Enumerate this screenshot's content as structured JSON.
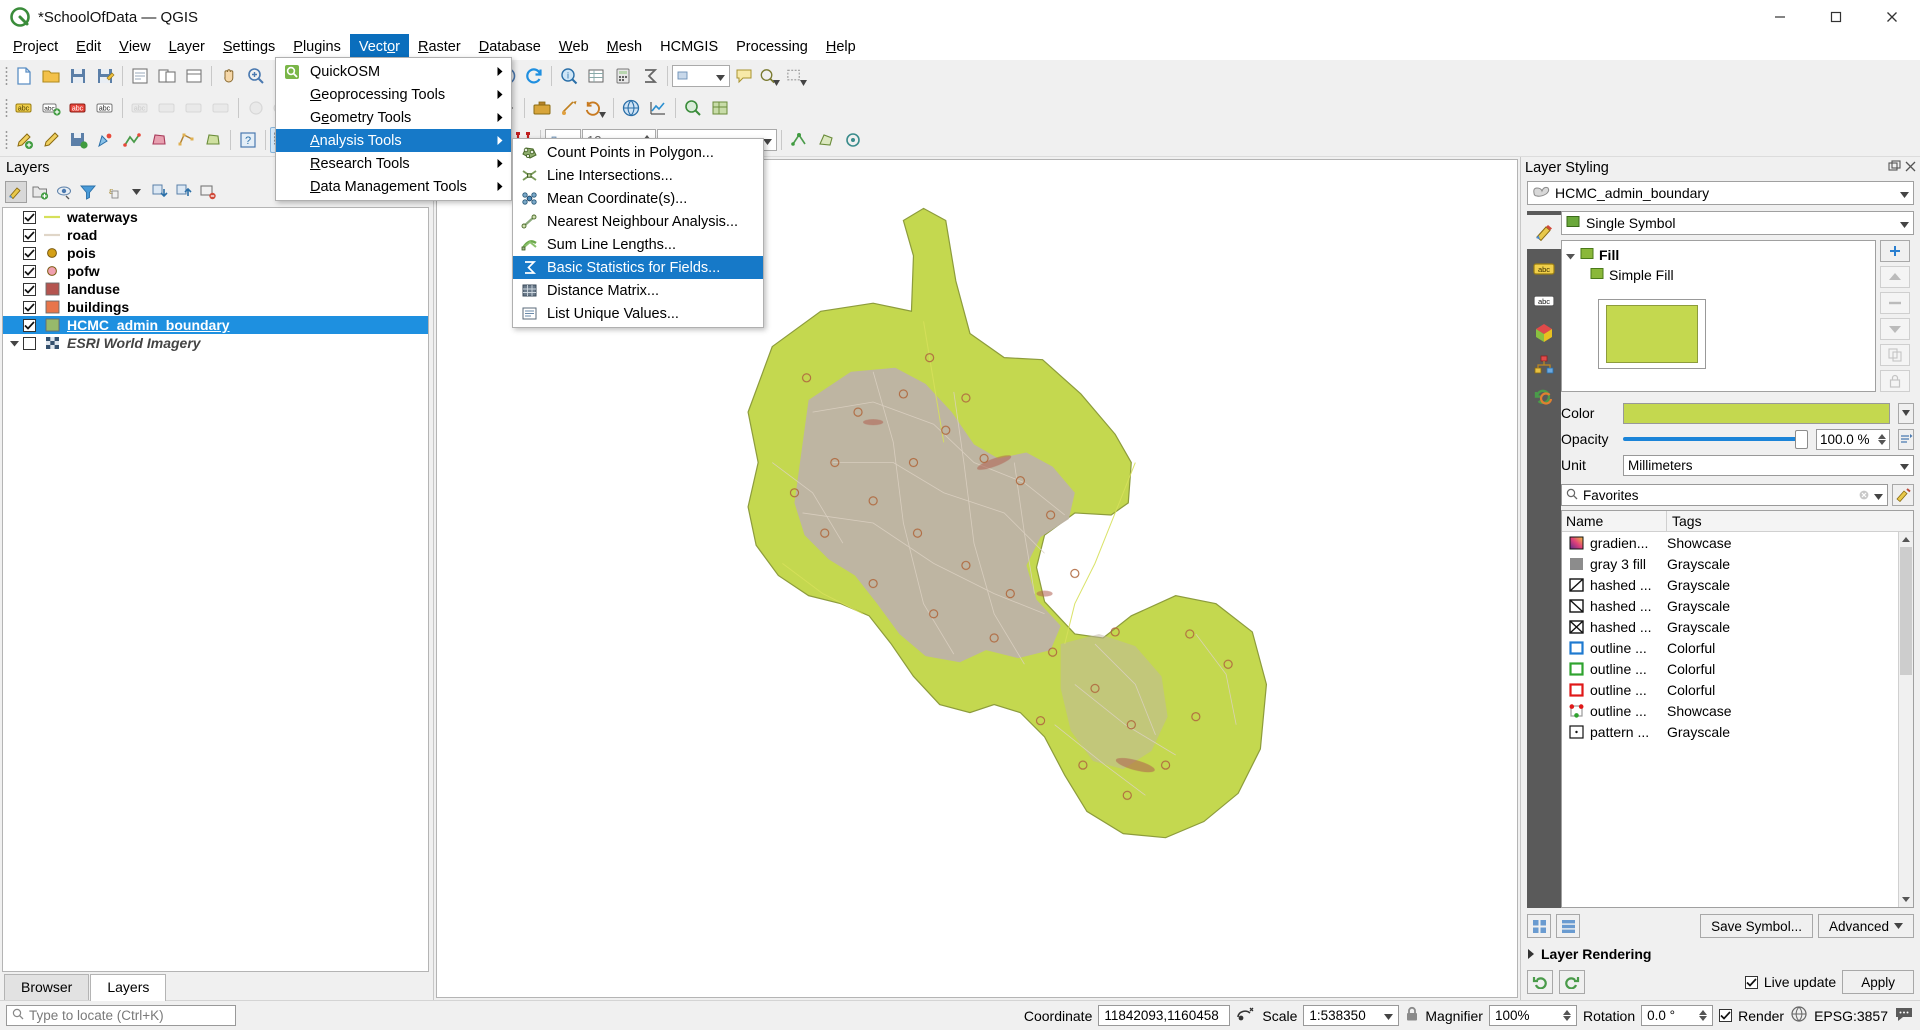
{
  "window": {
    "title": "*SchoolOfData — QGIS",
    "app_icon": "qgis-icon",
    "minimize_label": "Minimize",
    "maximize_label": "Maximize",
    "close_label": "Close"
  },
  "menubar": {
    "items": [
      {
        "label": "Project",
        "mnemonic": "P",
        "active": false
      },
      {
        "label": "Edit",
        "mnemonic": "E",
        "active": false
      },
      {
        "label": "View",
        "mnemonic": "V",
        "active": false
      },
      {
        "label": "Layer",
        "mnemonic": "L",
        "active": false
      },
      {
        "label": "Settings",
        "mnemonic": "S",
        "active": false
      },
      {
        "label": "Plugins",
        "mnemonic": "P",
        "active": false
      },
      {
        "label": "Vector",
        "mnemonic": "o",
        "active": true
      },
      {
        "label": "Raster",
        "mnemonic": "R",
        "active": false
      },
      {
        "label": "Database",
        "mnemonic": "D",
        "active": false
      },
      {
        "label": "Web",
        "mnemonic": "W",
        "active": false
      },
      {
        "label": "Mesh",
        "mnemonic": "M",
        "active": false
      },
      {
        "label": "HCMGIS",
        "mnemonic": "",
        "active": false
      },
      {
        "label": "Processing",
        "mnemonic": "",
        "active": false
      },
      {
        "label": "Help",
        "mnemonic": "H",
        "active": false
      }
    ]
  },
  "vector_menu": {
    "items": [
      {
        "label": "QuickOSM",
        "mnemonic": "",
        "icon": "quickosm-icon",
        "has_submenu": true,
        "highlight": false
      },
      {
        "label": "Geoprocessing Tools",
        "mnemonic": "G",
        "icon": "",
        "has_submenu": true,
        "highlight": false
      },
      {
        "label": "Geometry Tools",
        "mnemonic": "e",
        "icon": "",
        "has_submenu": true,
        "highlight": false
      },
      {
        "label": "Analysis Tools",
        "mnemonic": "A",
        "icon": "",
        "has_submenu": true,
        "highlight": true
      },
      {
        "label": "Research Tools",
        "mnemonic": "R",
        "icon": "",
        "has_submenu": true,
        "highlight": false
      },
      {
        "label": "Data Management Tools",
        "mnemonic": "D",
        "icon": "",
        "has_submenu": true,
        "highlight": false
      }
    ]
  },
  "analysis_submenu": {
    "items": [
      {
        "label": "Count Points in Polygon...",
        "icon": "count-points-icon",
        "highlight": false
      },
      {
        "label": "Line Intersections...",
        "icon": "line-intersections-icon",
        "highlight": false
      },
      {
        "label": "Mean Coordinate(s)...",
        "icon": "mean-coordinate-icon",
        "highlight": false
      },
      {
        "label": "Nearest Neighbour Analysis...",
        "icon": "nearest-neighbour-icon",
        "highlight": false
      },
      {
        "label": "Sum Line Lengths...",
        "icon": "sum-line-lengths-icon",
        "highlight": false
      },
      {
        "label": "Basic Statistics for Fields...",
        "icon": "basic-statistics-icon",
        "highlight": true
      },
      {
        "label": "Distance Matrix...",
        "icon": "distance-matrix-icon",
        "highlight": false
      },
      {
        "label": "List Unique Values...",
        "icon": "list-unique-values-icon",
        "highlight": false
      }
    ]
  },
  "layers_panel": {
    "title": "Layers",
    "toolbar": [
      {
        "name": "open-layer-styling-panel",
        "icon": "paintbrush-icon",
        "pressed": true
      },
      {
        "name": "add-group",
        "icon": "add-group-icon",
        "pressed": false
      },
      {
        "name": "manage-map-themes",
        "icon": "eye-icon",
        "pressed": false
      },
      {
        "name": "filter-legend",
        "icon": "filter-icon",
        "pressed": false
      },
      {
        "name": "filter-legend-expression",
        "icon": "epsilon-icon",
        "pressed": false
      },
      {
        "name": "expand-all",
        "icon": "expand-all-icon",
        "pressed": false
      },
      {
        "name": "collapse-all",
        "icon": "collapse-all-icon",
        "pressed": false
      },
      {
        "name": "remove-layer",
        "icon": "remove-layer-icon",
        "pressed": false
      }
    ],
    "layers": [
      {
        "name": "waterways",
        "checked": true,
        "symbol": "line",
        "color": "#d6e05a",
        "selected": false,
        "italic": false,
        "expander": false
      },
      {
        "name": "road",
        "checked": true,
        "symbol": "line",
        "color": "#e0d6c8",
        "selected": false,
        "italic": false,
        "expander": false
      },
      {
        "name": "pois",
        "checked": true,
        "symbol": "point",
        "color": "#d4a017",
        "selected": false,
        "italic": false,
        "expander": false
      },
      {
        "name": "pofw",
        "checked": true,
        "symbol": "point",
        "color": "#f0a0b0",
        "selected": false,
        "italic": false,
        "expander": false
      },
      {
        "name": "landuse",
        "checked": true,
        "symbol": "fill",
        "color": "#b4544f",
        "selected": false,
        "italic": false,
        "expander": false
      },
      {
        "name": "buildings",
        "checked": true,
        "symbol": "fill",
        "color": "#e8754a",
        "selected": false,
        "italic": false,
        "expander": false
      },
      {
        "name": "HCMC_admin_boundary",
        "checked": true,
        "symbol": "fill",
        "color": "#97b96b",
        "selected": true,
        "italic": false,
        "expander": false
      },
      {
        "name": "ESRI World Imagery",
        "checked": false,
        "symbol": "raster",
        "color": "#6a7f9c",
        "selected": false,
        "italic": true,
        "expander": true
      }
    ],
    "tabs": [
      {
        "label": "Browser",
        "active": false
      },
      {
        "label": "Layers",
        "active": true
      }
    ]
  },
  "layer_styling": {
    "title": "Layer Styling",
    "layer_name": "HCMC_admin_boundary",
    "renderer": "Single Symbol",
    "renderer_icon": "single-symbol-icon",
    "sidebar_icons": [
      "paintbrush-icon",
      "labels-icon",
      "masks-icon",
      "3d-view-icon",
      "diagrams-icon",
      "history-icon"
    ],
    "symbol_tree": [
      {
        "label": "Fill",
        "level": 0,
        "color": "#c4d84f",
        "expander": true
      },
      {
        "label": "Simple Fill",
        "level": 1,
        "color": "#c4d84f",
        "expander": false
      }
    ],
    "symbol_buttons": [
      {
        "name": "add-symbol-layer",
        "icon": "plus-icon",
        "enabled": true
      },
      {
        "name": "move-up",
        "icon": "arrow-up-icon",
        "enabled": false
      },
      {
        "name": "remove-symbol-layer",
        "icon": "minus-icon",
        "enabled": false
      },
      {
        "name": "move-down",
        "icon": "arrow-down-icon",
        "enabled": false
      },
      {
        "name": "duplicate-symbol-layer",
        "icon": "copy-icon",
        "enabled": false
      },
      {
        "name": "lock-symbol-layer",
        "icon": "lock-icon",
        "enabled": false
      }
    ],
    "preview_color": "#c4d84f",
    "color_label": "Color",
    "color_value": "#c4d84f",
    "opacity_label": "Opacity",
    "opacity_value": "100.0 %",
    "unit_label": "Unit",
    "unit_value": "Millimeters",
    "favorites_label": "Favorites",
    "symbol_table": {
      "columns": [
        "Name",
        "Tags"
      ],
      "rows": [
        {
          "name": "gradien...",
          "tag": "Showcase",
          "icon": "gradient-swatch"
        },
        {
          "name": "gray 3 fill",
          "tag": "Grayscale",
          "icon": "gray-swatch"
        },
        {
          "name": "hashed ...",
          "tag": "Grayscale",
          "icon": "hashed-fwd-swatch"
        },
        {
          "name": "hashed ...",
          "tag": "Grayscale",
          "icon": "hashed-back-swatch"
        },
        {
          "name": "hashed ...",
          "tag": "Grayscale",
          "icon": "hashed-cross-swatch"
        },
        {
          "name": "outline ...",
          "tag": "Colorful",
          "icon": "outline-blue-swatch"
        },
        {
          "name": "outline ...",
          "tag": "Colorful",
          "icon": "outline-green-swatch"
        },
        {
          "name": "outline ...",
          "tag": "Colorful",
          "icon": "outline-red-swatch"
        },
        {
          "name": "outline ...",
          "tag": "Showcase",
          "icon": "outline-dots-swatch"
        },
        {
          "name": "pattern ...",
          "tag": "Grayscale",
          "icon": "pattern-swatch"
        }
      ]
    },
    "save_symbol_label": "Save Symbol...",
    "advanced_label": "Advanced",
    "layer_rendering_label": "Layer Rendering",
    "live_update_label": "Live update",
    "live_update_checked": true,
    "apply_label": "Apply",
    "undo_icon": "undo-icon",
    "redo_icon": "redo-icon"
  },
  "statusbar": {
    "locator_placeholder": "Type to locate (Ctrl+K)",
    "coordinate_label": "Coordinate",
    "coordinate_value": "11842093,1160458",
    "scale_label": "Scale",
    "scale_value": "1:538350",
    "magnifier_label": "Magnifier",
    "magnifier_value": "100%",
    "rotation_label": "Rotation",
    "rotation_value": "0.0 °",
    "render_label": "Render",
    "render_checked": true,
    "crs_label": "EPSG:3857",
    "messages_icon": "messages-icon"
  },
  "colors": {
    "accent": "#1679c8",
    "selection": "#1e90e0",
    "map_land": "#c4d84f",
    "map_urban": "#bdb3a6",
    "dock_sidebar": "#5a5a5a"
  }
}
